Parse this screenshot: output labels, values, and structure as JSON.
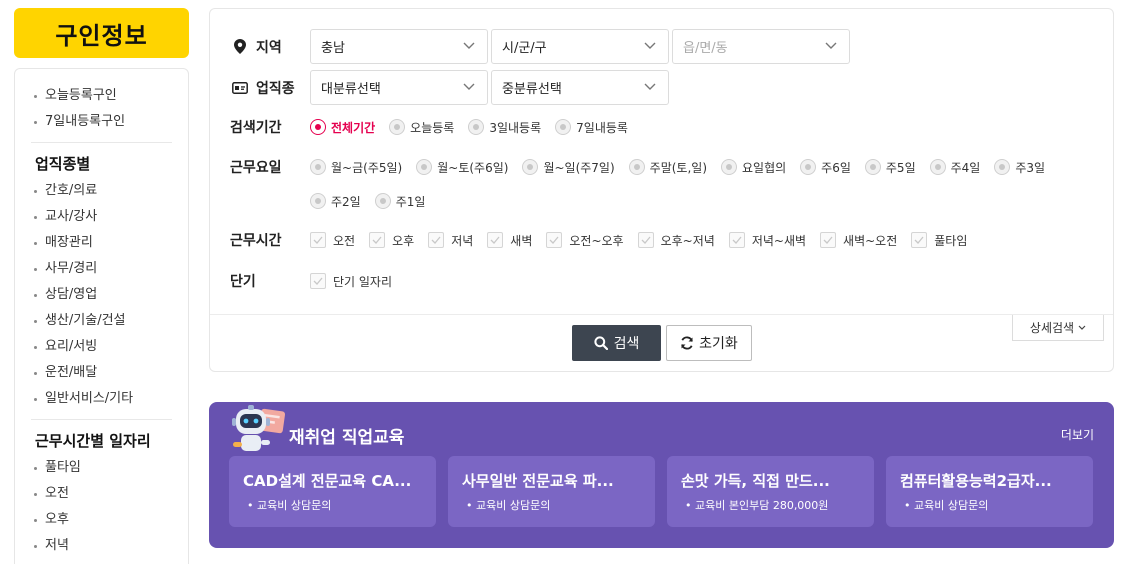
{
  "sidebar": {
    "title": "구인정보",
    "quick": [
      "오늘등록구인",
      "7일내등록구인"
    ],
    "sections": [
      {
        "heading": "업직종별",
        "items": [
          "간호/의료",
          "교사/강사",
          "매장관리",
          "사무/경리",
          "상담/영업",
          "생산/기술/건설",
          "요리/서빙",
          "운전/배달",
          "일반서비스/기타"
        ]
      },
      {
        "heading": "근무시간별 일자리",
        "items": [
          "풀타임",
          "오전",
          "오후",
          "저녁"
        ]
      }
    ]
  },
  "search": {
    "region": {
      "label": "지역",
      "selects": [
        "충남",
        "시/군/구",
        "읍/면/동"
      ]
    },
    "job": {
      "label": "업직종",
      "selects": [
        "대분류선택",
        "중분류선택"
      ]
    },
    "period": {
      "label": "검색기간",
      "options": [
        "전체기간",
        "오늘등록",
        "3일내등록",
        "7일내등록"
      ],
      "selected": "전체기간"
    },
    "days": {
      "label": "근무요일",
      "options": [
        "월~금(주5일)",
        "월~토(주6일)",
        "월~일(주7일)",
        "주말(토,일)",
        "요일협의",
        "주6일",
        "주5일",
        "주4일",
        "주3일",
        "주2일",
        "주1일"
      ]
    },
    "hours": {
      "label": "근무시간",
      "options": [
        "오전",
        "오후",
        "저녁",
        "새벽",
        "오전~오후",
        "오후~저녁",
        "저녁~새벽",
        "새벽~오전",
        "풀타임"
      ]
    },
    "short": {
      "label": "단기",
      "options": [
        "단기 일자리"
      ]
    },
    "search_label": "검색",
    "reset_label": "초기화",
    "detail_label": "상세검색"
  },
  "edu": {
    "title": "재취업 직업교육",
    "more": "더보기",
    "cards": [
      {
        "title": "CAD설계 전문교육 CA...",
        "sub": "• 교육비 상담문의"
      },
      {
        "title": "사무일반 전문교육 파...",
        "sub": "• 교육비 상담문의"
      },
      {
        "title": "손맛 가득, 직접 만드...",
        "sub": "• 교육비 본인부담 280,000원"
      },
      {
        "title": "컴퓨터활용능력2급자...",
        "sub": "• 교육비 상담문의"
      }
    ]
  },
  "colors": {
    "accent_yellow": "#ffd400",
    "selected_red": "#e5004f",
    "banner_purple": "#6752b0",
    "button_dark": "#3d4550"
  },
  "icons": {
    "region": "location-pin-icon",
    "job": "id-card-icon",
    "search": "search-icon",
    "reset": "refresh-icon",
    "dropdown": "chevron-down-icon"
  }
}
